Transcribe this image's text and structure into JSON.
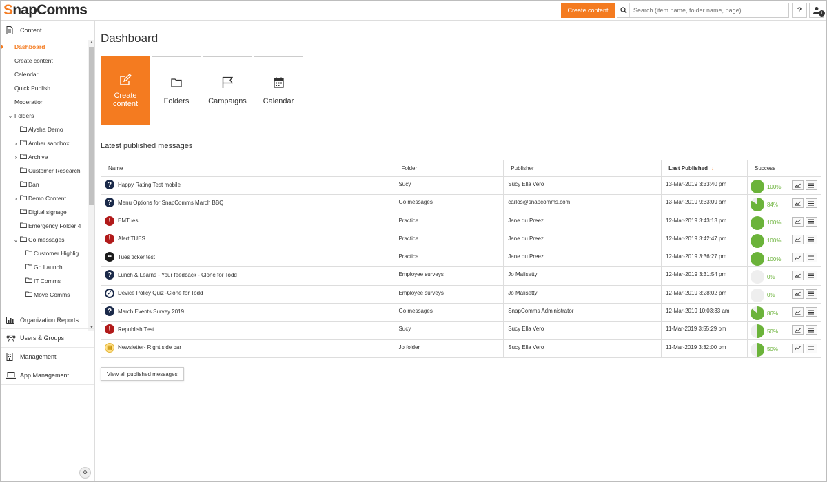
{
  "app": {
    "logo_text": "SnapComms",
    "create_button": "Create content",
    "search_placeholder": "Search (item name, folder name, page)",
    "help_label": "?",
    "notification_count": "1"
  },
  "sidebar": {
    "content_label": "Content",
    "items": [
      {
        "label": "Dashboard"
      },
      {
        "label": "Create content"
      },
      {
        "label": "Calendar"
      },
      {
        "label": "Quick Publish"
      },
      {
        "label": "Moderation"
      },
      {
        "label": "Folders"
      },
      {
        "label": "Alysha Demo"
      },
      {
        "label": "Amber sandbox"
      },
      {
        "label": "Archive"
      },
      {
        "label": "Customer Research"
      },
      {
        "label": "Dan"
      },
      {
        "label": "Demo Content"
      },
      {
        "label": "Digital signage"
      },
      {
        "label": "Emergency Folder 4"
      },
      {
        "label": "Go messages"
      },
      {
        "label": "Customer Highlig..."
      },
      {
        "label": "Go Launch"
      },
      {
        "label": "IT Comms"
      },
      {
        "label": "Move Comms"
      }
    ],
    "bottom": [
      {
        "label": "Organization Reports",
        "icon": "bar-chart-icon"
      },
      {
        "label": "Users & Groups",
        "icon": "users-icon"
      },
      {
        "label": "Management",
        "icon": "building-icon"
      },
      {
        "label": "App Management",
        "icon": "laptop-icon"
      }
    ]
  },
  "main": {
    "title": "Dashboard",
    "tiles": [
      {
        "label_line1": "Create",
        "label_line2": "content",
        "icon": "edit-icon"
      },
      {
        "label_line1": "Folders",
        "label_line2": "",
        "icon": "folder-icon"
      },
      {
        "label_line1": "Campaigns",
        "label_line2": "",
        "icon": "flag-icon"
      },
      {
        "label_line1": "Calendar",
        "label_line2": "",
        "icon": "calendar-icon"
      }
    ],
    "section_title": "Latest published messages",
    "table": {
      "headers": {
        "name": "Name",
        "folder": "Folder",
        "publisher": "Publisher",
        "last_published": "Last Published",
        "success": "Success"
      },
      "rows": [
        {
          "icon": "question-icon",
          "name": "Happy Rating Test mobile",
          "folder": "Sucy",
          "publisher": "Sucy Ella Vero",
          "date": "13-Mar-2019 3:33:40 pm",
          "success": "100%",
          "pct": 100
        },
        {
          "icon": "question-icon",
          "name": "Menu Options for SnapComms March BBQ",
          "folder": "Go messages",
          "publisher": "carlos@snapcomms.com",
          "date": "13-Mar-2019 9:33:09 am",
          "success": "84%",
          "pct": 84
        },
        {
          "icon": "alert-icon",
          "name": "EMTues",
          "folder": "Practice",
          "publisher": "Jane du Preez",
          "date": "12-Mar-2019 3:43:13 pm",
          "success": "100%",
          "pct": 100
        },
        {
          "icon": "alert-icon",
          "name": "Alert TUES",
          "folder": "Practice",
          "publisher": "Jane du Preez",
          "date": "12-Mar-2019 3:42:47 pm",
          "success": "100%",
          "pct": 100
        },
        {
          "icon": "ticker-icon",
          "name": "Tues ticker test",
          "folder": "Practice",
          "publisher": "Jane du Preez",
          "date": "12-Mar-2019 3:36:27 pm",
          "success": "100%",
          "pct": 100
        },
        {
          "icon": "question-icon",
          "name": "Lunch & Learns - Your feedback - Clone for Todd",
          "folder": "Employee surveys",
          "publisher": "Jo Malisetty",
          "date": "12-Mar-2019 3:31:54 pm",
          "success": "0%",
          "pct": 0
        },
        {
          "icon": "quiz-check-icon",
          "name": "Device Policy Quiz -Clone for Todd",
          "folder": "Employee surveys",
          "publisher": "Jo Malisetty",
          "date": "12-Mar-2019 3:28:02 pm",
          "success": "0%",
          "pct": 0
        },
        {
          "icon": "question-icon",
          "name": "March Events Survey 2019",
          "folder": "Go messages",
          "publisher": "SnapComms Administrator",
          "date": "12-Mar-2019 10:03:33 am",
          "success": "86%",
          "pct": 86
        },
        {
          "icon": "alert-icon",
          "name": "Republish Test",
          "folder": "Sucy",
          "publisher": "Sucy Ella Vero",
          "date": "11-Mar-2019 3:55:29 pm",
          "success": "50%",
          "pct": 50
        },
        {
          "icon": "newsletter-icon",
          "name": "Newsletter- Right side bar",
          "folder": "Jo folder",
          "publisher": "Sucy Ella Vero",
          "date": "11-Mar-2019 3:32:00 pm",
          "success": "50%",
          "pct": 50
        }
      ]
    },
    "view_all_label": "View all published messages"
  },
  "colors": {
    "accent": "#f47b20",
    "success": "#6bb33a",
    "pie_empty": "#eeeeee"
  }
}
